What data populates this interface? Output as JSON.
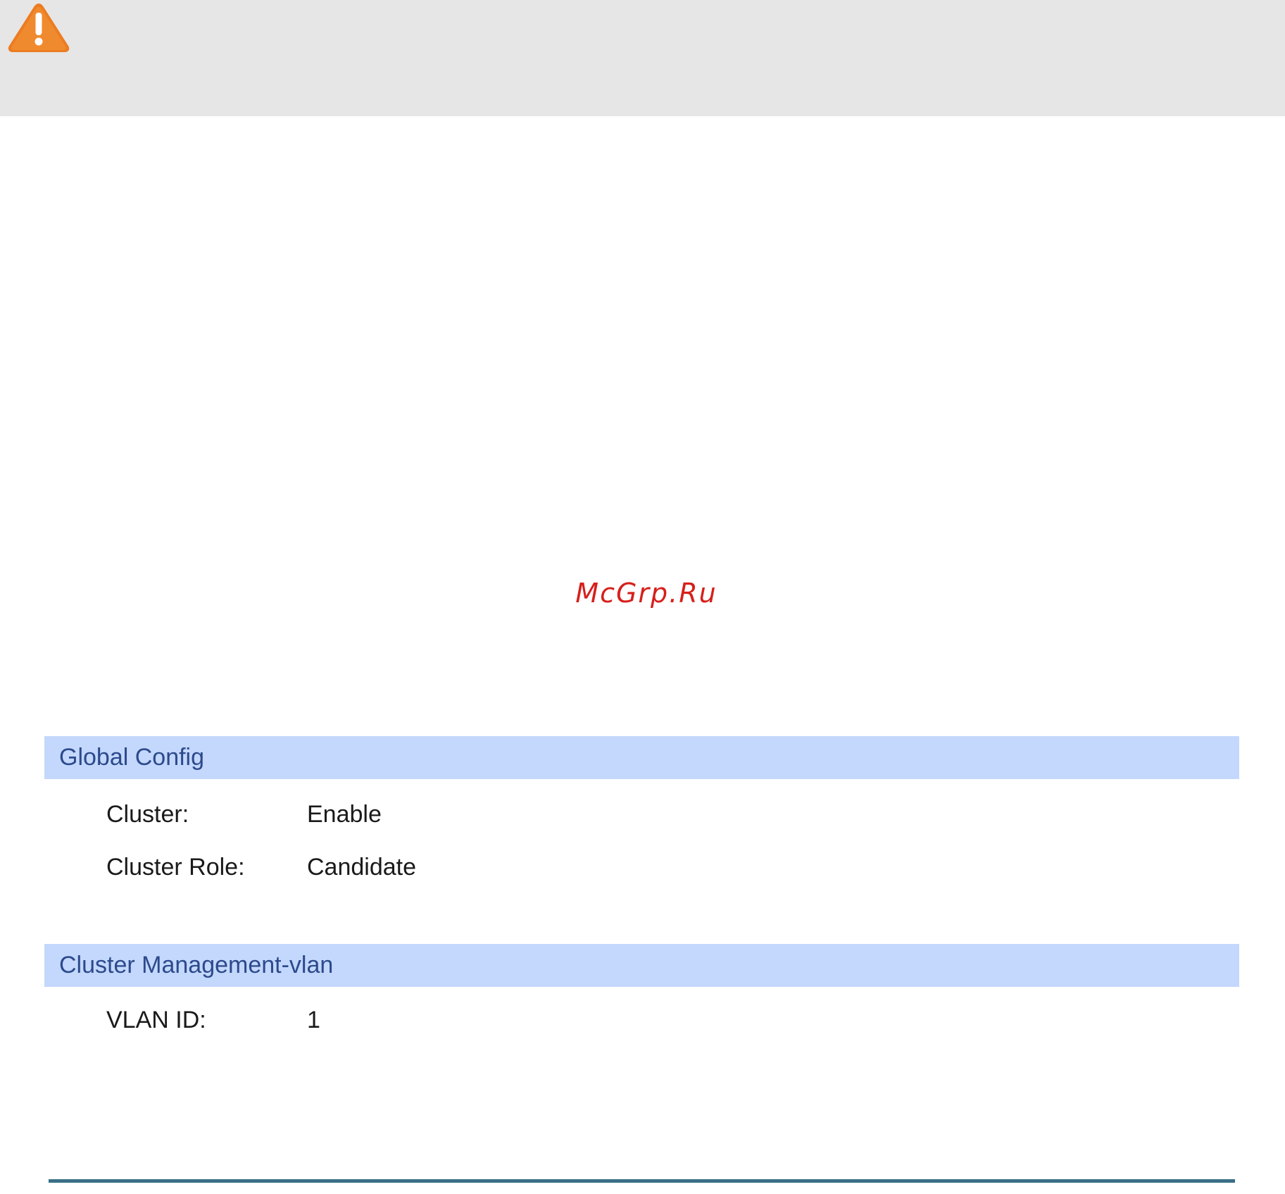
{
  "watermark": "McGrp.Ru",
  "global_config": {
    "header": "Global Config",
    "fields": [
      {
        "label": "Cluster:",
        "value": "Enable"
      },
      {
        "label": "Cluster Role:",
        "value": "Candidate"
      }
    ]
  },
  "cluster_management_vlan": {
    "header": "Cluster Management-vlan",
    "fields": [
      {
        "label": "VLAN ID:",
        "value": "1"
      }
    ]
  },
  "colors": {
    "note_background": "#e6e6e6",
    "warning_icon": "#ec7c22",
    "watermark": "#d6201b",
    "section_header_background": "#c4d8fd",
    "section_header_text": "#2c4a8c",
    "bottom_rule": "#3a6f86"
  },
  "icons": [
    "warning-icon"
  ]
}
